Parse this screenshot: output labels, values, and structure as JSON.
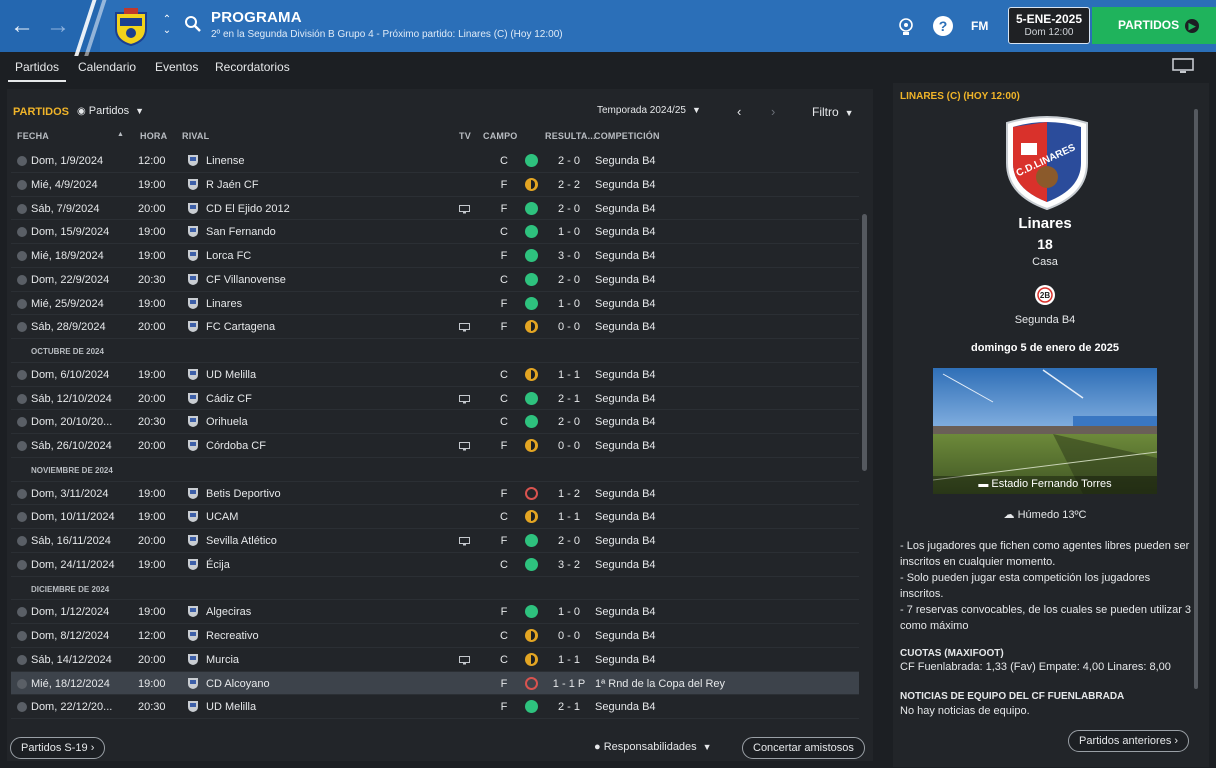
{
  "header": {
    "title": "PROGRAMA",
    "subtitle": "2º en la Segunda División B Grupo 4 - Próximo partido: Linares (C)  (Hoy 12:00)",
    "fm_label": "FM",
    "date": "5-ENE-2025",
    "time": "Dom 12:00",
    "partidos_button": "PARTIDOS"
  },
  "tabs": [
    "Partidos",
    "Calendario",
    "Eventos",
    "Recordatorios"
  ],
  "panel": {
    "title": "PARTIDOS",
    "view_dropdown": "Partidos",
    "season_dropdown": "Temporada 2024/25",
    "filter": "Filtro"
  },
  "columns": {
    "fecha": "FECHA",
    "hora": "HORA",
    "rival": "RIVAL",
    "tv": "TV",
    "campo": "CAMPO",
    "resultado": "RESULTA...",
    "competicion": "COMPETICIÓN"
  },
  "months": {
    "oct": "OCTUBRE DE 2024",
    "nov": "NOVIEMBRE DE 2024",
    "dic": "DICIEMBRE DE 2024"
  },
  "matches": {
    "m1": {
      "date": "Dom, 1/9/2024",
      "time": "12:00",
      "rival": "Linense",
      "tv": false,
      "campo": "C",
      "res": "g",
      "score": "2 - 0",
      "comp": "Segunda B4"
    },
    "m2": {
      "date": "Mié, 4/9/2024",
      "time": "19:00",
      "rival": "R Jaén CF",
      "tv": false,
      "campo": "F",
      "res": "y",
      "score": "2 - 2",
      "comp": "Segunda B4"
    },
    "m3": {
      "date": "Sáb, 7/9/2024",
      "time": "20:00",
      "rival": "CD El Ejido 2012",
      "tv": true,
      "campo": "F",
      "res": "g",
      "score": "2 - 0",
      "comp": "Segunda B4"
    },
    "m4": {
      "date": "Dom, 15/9/2024",
      "time": "19:00",
      "rival": "San Fernando",
      "tv": false,
      "campo": "C",
      "res": "g",
      "score": "1 - 0",
      "comp": "Segunda B4"
    },
    "m5": {
      "date": "Mié, 18/9/2024",
      "time": "19:00",
      "rival": "Lorca FC",
      "tv": false,
      "campo": "F",
      "res": "g",
      "score": "3 - 0",
      "comp": "Segunda B4"
    },
    "m6": {
      "date": "Dom, 22/9/2024",
      "time": "20:30",
      "rival": "CF Villanovense",
      "tv": false,
      "campo": "C",
      "res": "g",
      "score": "2 - 0",
      "comp": "Segunda B4"
    },
    "m7": {
      "date": "Mié, 25/9/2024",
      "time": "19:00",
      "rival": "Linares",
      "tv": false,
      "campo": "F",
      "res": "g",
      "score": "1 - 0",
      "comp": "Segunda B4"
    },
    "m8": {
      "date": "Sáb, 28/9/2024",
      "time": "20:00",
      "rival": "FC Cartagena",
      "tv": true,
      "campo": "F",
      "res": "y",
      "score": "0 - 0",
      "comp": "Segunda B4"
    },
    "m9": {
      "date": "Dom, 6/10/2024",
      "time": "19:00",
      "rival": "UD Melilla",
      "tv": false,
      "campo": "C",
      "res": "y",
      "score": "1 - 1",
      "comp": "Segunda B4"
    },
    "m10": {
      "date": "Sáb, 12/10/2024",
      "time": "20:00",
      "rival": "Cádiz CF",
      "tv": true,
      "campo": "C",
      "res": "g",
      "score": "2 - 1",
      "comp": "Segunda B4"
    },
    "m11": {
      "date": "Dom, 20/10/20...",
      "time": "20:30",
      "rival": "Orihuela",
      "tv": false,
      "campo": "C",
      "res": "g",
      "score": "2 - 0",
      "comp": "Segunda B4"
    },
    "m12": {
      "date": "Sáb, 26/10/2024",
      "time": "20:00",
      "rival": "Córdoba CF",
      "tv": true,
      "campo": "F",
      "res": "y",
      "score": "0 - 0",
      "comp": "Segunda B4"
    },
    "m13": {
      "date": "Dom, 3/11/2024",
      "time": "19:00",
      "rival": "Betis Deportivo",
      "tv": false,
      "campo": "F",
      "res": "r",
      "score": "1 - 2",
      "comp": "Segunda B4"
    },
    "m14": {
      "date": "Dom, 10/11/2024",
      "time": "19:00",
      "rival": "UCAM",
      "tv": false,
      "campo": "C",
      "res": "y",
      "score": "1 - 1",
      "comp": "Segunda B4"
    },
    "m15": {
      "date": "Sáb, 16/11/2024",
      "time": "20:00",
      "rival": "Sevilla Atlético",
      "tv": true,
      "campo": "F",
      "res": "g",
      "score": "2 - 0",
      "comp": "Segunda B4"
    },
    "m16": {
      "date": "Dom, 24/11/2024",
      "time": "19:00",
      "rival": "Écija",
      "tv": false,
      "campo": "C",
      "res": "g",
      "score": "3 - 2",
      "comp": "Segunda B4"
    },
    "m17": {
      "date": "Dom, 1/12/2024",
      "time": "19:00",
      "rival": "Algeciras",
      "tv": false,
      "campo": "F",
      "res": "g",
      "score": "1 - 0",
      "comp": "Segunda B4"
    },
    "m18": {
      "date": "Dom, 8/12/2024",
      "time": "12:00",
      "rival": "Recreativo",
      "tv": false,
      "campo": "C",
      "res": "y",
      "score": "0 - 0",
      "comp": "Segunda B4"
    },
    "m19": {
      "date": "Sáb, 14/12/2024",
      "time": "20:00",
      "rival": "Murcia",
      "tv": true,
      "campo": "C",
      "res": "y",
      "score": "1 - 1",
      "comp": "Segunda B4"
    },
    "m20": {
      "date": "Mié, 18/12/2024",
      "time": "19:00",
      "rival": "CD Alcoyano",
      "tv": false,
      "campo": "F",
      "res": "r",
      "score": "1 - 1 P",
      "comp": "1ª Rnd de la Copa del Rey"
    },
    "m21": {
      "date": "Dom, 22/12/20...",
      "time": "20:30",
      "rival": "UD Melilla",
      "tv": false,
      "campo": "F",
      "res": "g",
      "score": "2 - 1",
      "comp": "Segunda B4"
    }
  },
  "footer": {
    "left_button": "Partidos S-19",
    "responsabilidades": "Responsabilidades",
    "amistosos": "Concertar amistosos"
  },
  "side": {
    "title": "LINARES (C)  (HOY 12:00)",
    "club_name": "Linares",
    "position": "18",
    "venue": "Casa",
    "competition": "Segunda B4",
    "date_long": "domingo 5 de enero de 2025",
    "stadium": "Estadio Fernando Torres",
    "weather": "Húmedo 13ºC",
    "notes": [
      "- Los jugadores que fichen como agentes libres pueden ser inscritos en cualquier momento.",
      "- Solo pueden jugar esta competición los jugadores inscritos.",
      "- 7 reservas convocables, de los cuales se pueden utilizar 3 como máximo"
    ],
    "odds_title": "CUOTAS (MAXIFOOT)",
    "odds_text": "CF Fuenlabrada: 1,33 (Fav) Empate: 4,00 Linares: 8,00",
    "news_title": "NOTICIAS DE EQUIPO DEL CF FUENLABRADA",
    "news_text": "No hay noticias de equipo.",
    "prev_button": "Partidos anteriores"
  },
  "colors": {
    "accent": "#f0b429",
    "topbar": "#2b6fb8",
    "win": "#2ec27e",
    "draw": "#e3a523",
    "loss": "#d9534f"
  }
}
